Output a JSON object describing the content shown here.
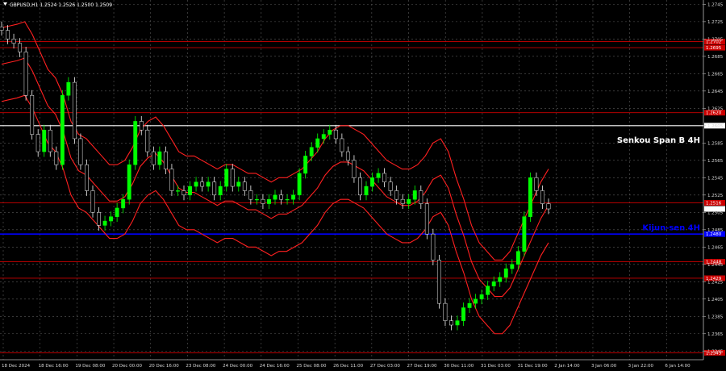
{
  "chart_data": {
    "type": "candlestick",
    "title": "GBPUSD,H1  1.2524 1.2526 1.2500 1.2509",
    "ylim": [
      1.2335,
      1.275
    ],
    "y_ticks": [
      "1.2745",
      "1.2725",
      "1.2705",
      "1.2685",
      "1.2665",
      "1.2645",
      "1.2625",
      "1.2605",
      "1.2585",
      "1.2565",
      "1.2545",
      "1.2525",
      "1.2505",
      "1.2485",
      "1.2465",
      "1.2445",
      "1.2425",
      "1.2405",
      "1.2385",
      "1.2365",
      "1.2345"
    ],
    "x_ticks": [
      "18 Dec 2024",
      "18 Dec 16:00",
      "19 Dec 08:00",
      "20 Dec 00:00",
      "20 Dec 16:00",
      "23 Dec 08:00",
      "24 Dec 00:00",
      "24 Dec 16:00",
      "25 Dec 08:00",
      "26 Dec 11:00",
      "27 Dec 03:00",
      "27 Dec 19:00",
      "30 Dec 11:00",
      "31 Dec 03:00",
      "31 Dec 19:00",
      "2 Jan 14:00",
      "3 Jan 06:00",
      "3 Jan 22:00",
      "6 Jan 14:00"
    ],
    "current_price": "1.2509",
    "horizontal_levels": [
      {
        "price": 1.2702,
        "label": "1.2702",
        "color": "#cc0000"
      },
      {
        "price": 1.2695,
        "label": "1.2695",
        "color": "#cc0000"
      },
      {
        "price": 1.262,
        "label": "1.2620",
        "color": "#cc0000"
      },
      {
        "price": 1.2605,
        "label": "1.2608",
        "color": "#ffffff"
      },
      {
        "price": 1.2516,
        "label": "1.2516",
        "color": "#cc0000"
      },
      {
        "price": 1.248,
        "label": "1.2480",
        "color": "#0000ff"
      },
      {
        "price": 1.2448,
        "label": "1.2448",
        "color": "#cc0000"
      },
      {
        "price": 1.2429,
        "label": "1.2429",
        "color": "#cc0000"
      },
      {
        "price": 1.2343,
        "label": "1.2343",
        "color": "#cc0000"
      }
    ],
    "annotations": [
      {
        "text": "Senkou Span B 4H",
        "price": 1.2589,
        "color": "#ffffff"
      },
      {
        "text": "Kijun-sen 4H",
        "price": 1.2488,
        "color": "#0000ff"
      }
    ],
    "close_series": [
      1.2715,
      1.2705,
      1.27,
      1.269,
      1.264,
      1.2595,
      1.2575,
      1.26,
      1.2575,
      1.256,
      1.264,
      1.2655,
      1.259,
      1.256,
      1.253,
      1.2505,
      1.249,
      1.2495,
      1.25,
      1.251,
      1.252,
      1.256,
      1.261,
      1.26,
      1.2575,
      1.256,
      1.2575,
      1.2555,
      1.253,
      1.253,
      1.2525,
      1.2535,
      1.254,
      1.2535,
      1.254,
      1.2525,
      1.2535,
      1.2555,
      1.2535,
      1.254,
      1.253,
      1.252,
      1.252,
      1.2515,
      1.252,
      1.2525,
      1.252,
      1.252,
      1.2525,
      1.255,
      1.257,
      1.258,
      1.259,
      1.2595,
      1.26,
      1.259,
      1.2575,
      1.2565,
      1.2545,
      1.2525,
      1.2535,
      1.2545,
      1.255,
      1.254,
      1.253,
      1.252,
      1.2515,
      1.252,
      1.253,
      1.2515,
      1.248,
      1.245,
      1.24,
      1.238,
      1.2375,
      1.238,
      1.2395,
      1.24,
      1.2405,
      1.241,
      1.242,
      1.2425,
      1.243,
      1.244,
      1.2445,
      1.246,
      1.25,
      1.2545,
      1.253,
      1.2515,
      1.2509
    ],
    "ichimoku_envelope_top": [
      1.2718,
      1.272,
      1.2722,
      1.2725,
      1.271,
      1.269,
      1.267,
      1.266,
      1.264,
      1.261,
      1.2595,
      1.259,
      1.258,
      1.257,
      1.256,
      1.256,
      1.2565,
      1.258,
      1.26,
      1.261,
      1.2615,
      1.2605,
      1.259,
      1.2575,
      1.257,
      1.257,
      1.2565,
      1.256,
      1.2555,
      1.256,
      1.256,
      1.2555,
      1.255,
      1.255,
      1.2545,
      1.254,
      1.2545,
      1.2545,
      1.255,
      1.2555,
      1.2565,
      1.2575,
      1.259,
      1.26,
      1.2605,
      1.2605,
      1.26,
      1.2595,
      1.2585,
      1.2575,
      1.2565,
      1.256,
      1.2555,
      1.2555,
      1.256,
      1.257,
      1.2585,
      1.259,
      1.2575,
      1.2545,
      1.252,
      1.249,
      1.247,
      1.246,
      1.245,
      1.245,
      1.246,
      1.248,
      1.25,
      1.252,
      1.254,
      1.2555
    ]
  }
}
